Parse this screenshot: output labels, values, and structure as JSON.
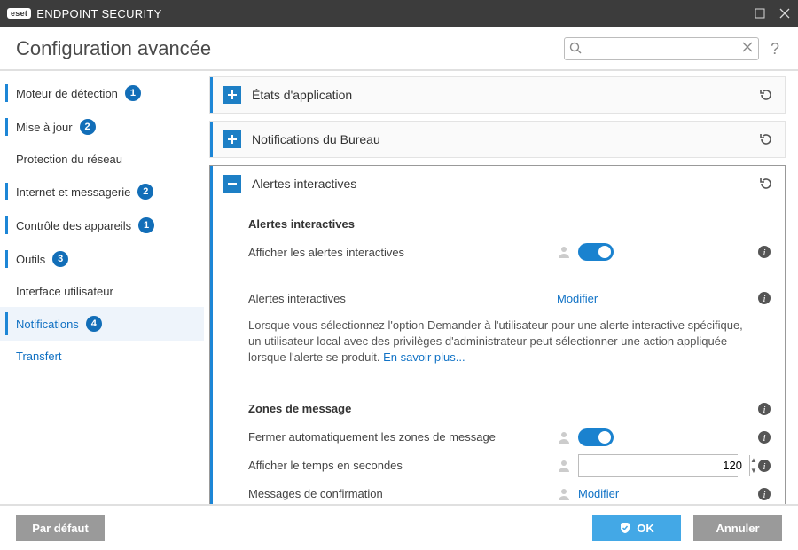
{
  "app": {
    "brand_mark": "eset",
    "product": "ENDPOINT SECURITY",
    "page_title": "Configuration avancée"
  },
  "search": {
    "value": ""
  },
  "sidebar": {
    "items": [
      {
        "label": "Moteur de détection",
        "badge": "1"
      },
      {
        "label": "Mise à jour",
        "badge": "2"
      },
      {
        "label": "Protection du réseau",
        "badge": ""
      },
      {
        "label": "Internet et messagerie",
        "badge": "2"
      },
      {
        "label": "Contrôle des appareils",
        "badge": "1"
      },
      {
        "label": "Outils",
        "badge": "3"
      },
      {
        "label": "Interface utilisateur",
        "badge": ""
      },
      {
        "label": "Notifications",
        "badge": "4"
      },
      {
        "label": "Transfert",
        "badge": ""
      }
    ]
  },
  "panels": {
    "app_states": {
      "title": "États d'application"
    },
    "desktop_notifications": {
      "title": "Notifications du Bureau"
    },
    "interactive_alerts": {
      "title": "Alertes interactives",
      "section1_title": "Alertes interactives",
      "show_alerts_label": "Afficher les alertes interactives",
      "alerts_row_label": "Alertes interactives",
      "modify_link": "Modifier",
      "desc_prefix": "Lorsque vous sélectionnez l'option Demander à l'utilisateur pour une alerte interactive spécifique, un utilisateur local avec des privilèges d'administrateur peut sélectionner une action appliquée lorsque l'alerte se produit. ",
      "learn_more": "En savoir plus...",
      "section2_title": "Zones de message",
      "auto_close_label": "Fermer automatiquement les zones de message",
      "time_label": "Afficher le temps en secondes",
      "time_value": "120",
      "confirm_label": "Messages de confirmation",
      "confirm_link": "Modifier"
    }
  },
  "footer": {
    "default_btn": "Par défaut",
    "ok_btn": "OK",
    "cancel_btn": "Annuler"
  }
}
